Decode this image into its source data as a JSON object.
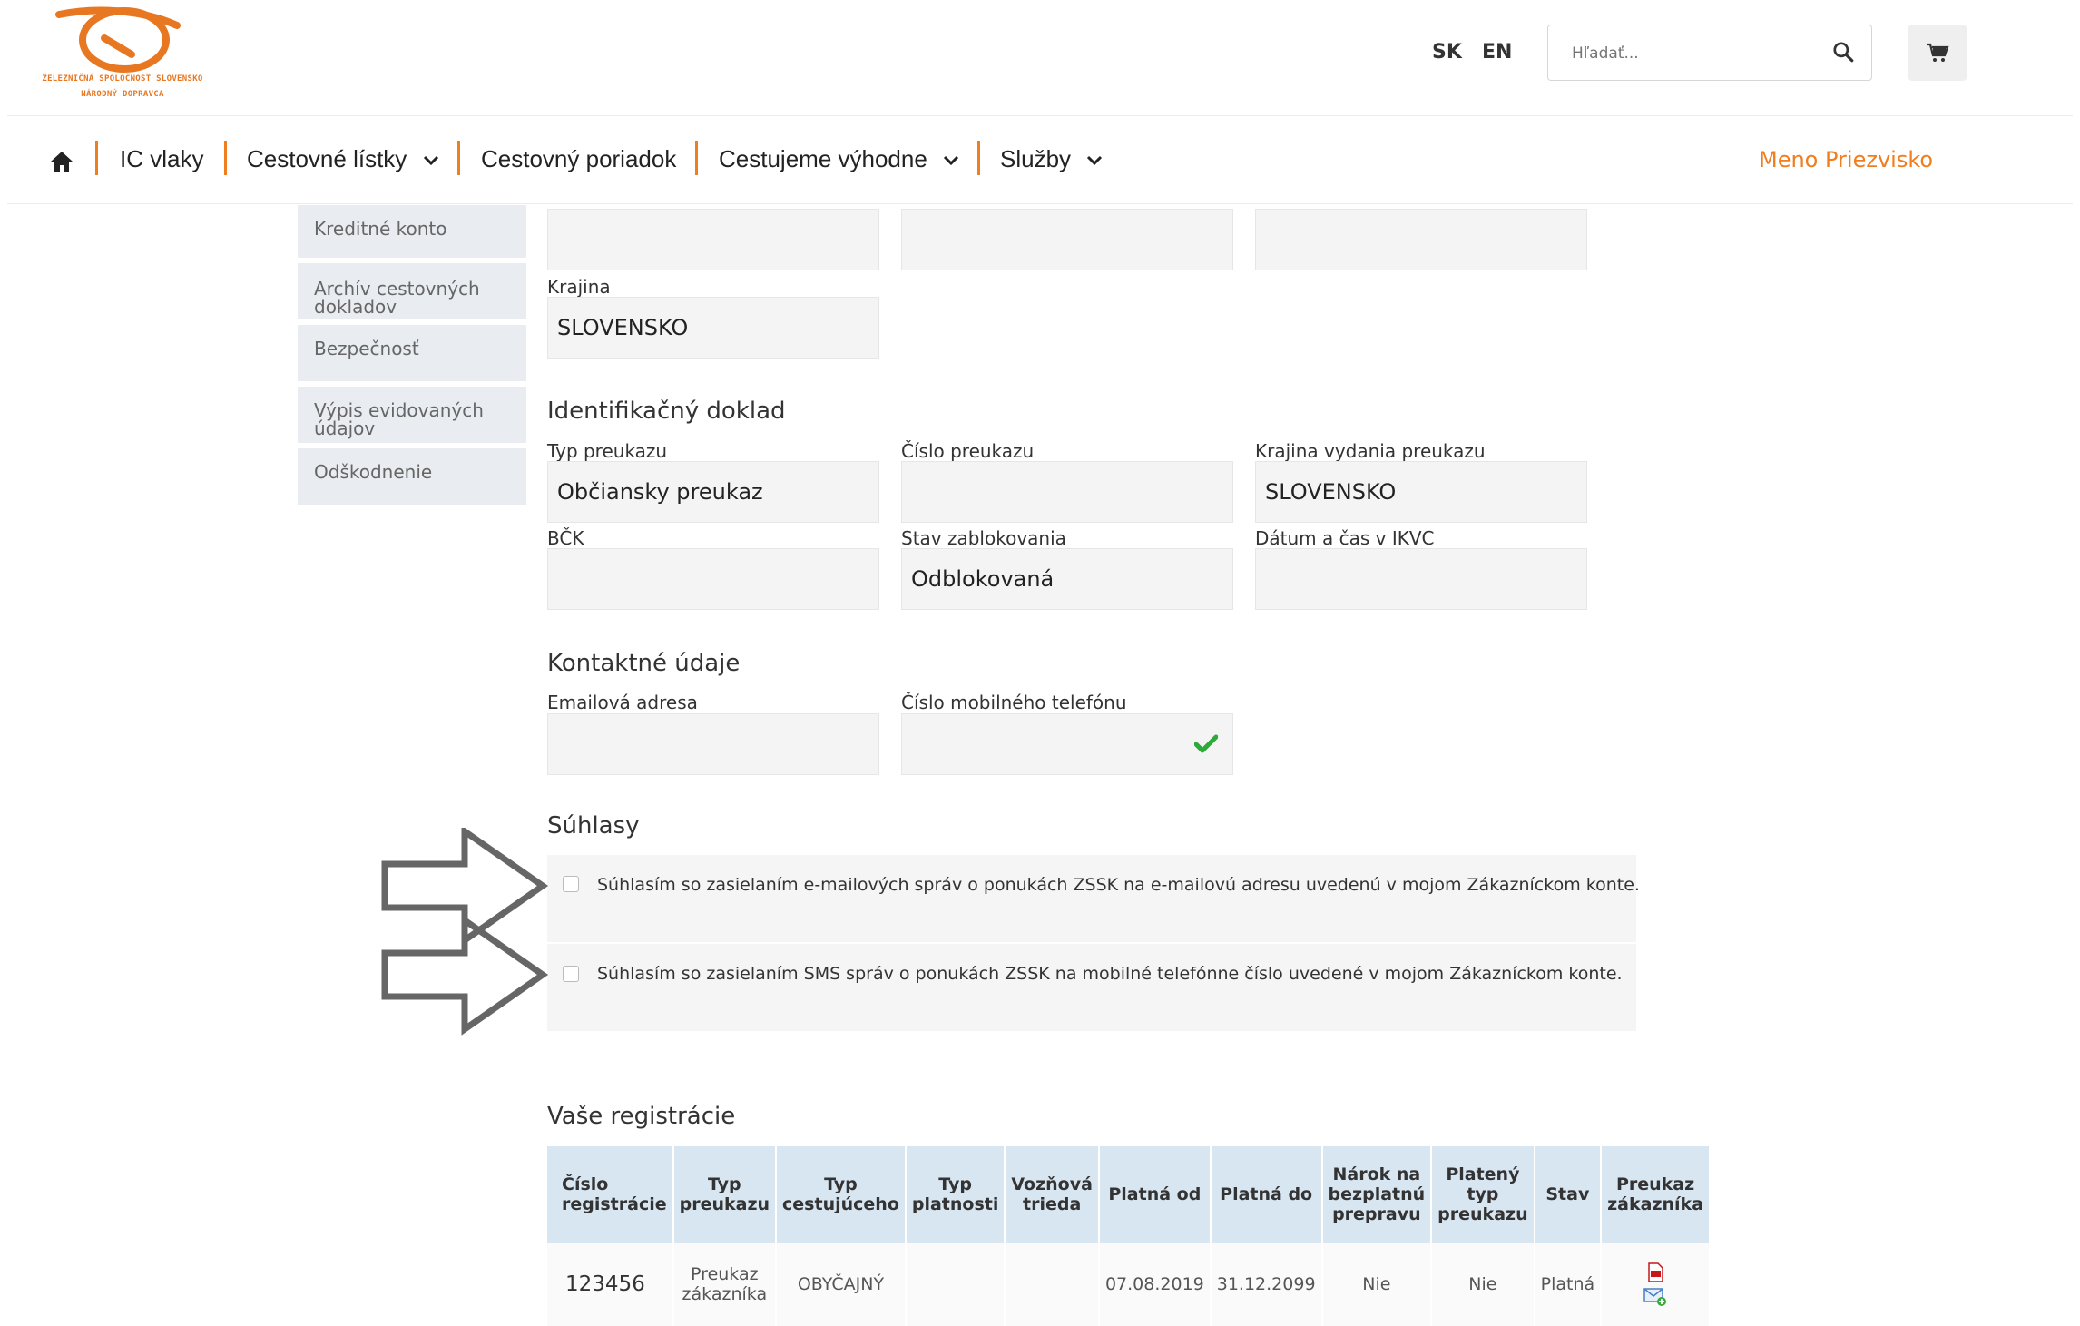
{
  "logo": {
    "line1": "ŽELEZNIČNÁ SPOLOČNOSŤ SLOVENSKO",
    "line2": "NÁRODNÝ DOPRAVCA"
  },
  "header": {
    "lang_sk": "SK",
    "lang_en": "EN",
    "search_placeholder": "Hľadať...",
    "user_name": "Meno Priezvisko"
  },
  "nav": {
    "items": [
      {
        "label": "IC vlaky"
      },
      {
        "label": "Cestovné lístky"
      },
      {
        "label": "Cestovný poriadok"
      },
      {
        "label": "Cestujeme výhodne"
      },
      {
        "label": "Služby"
      }
    ]
  },
  "sidebar": {
    "items": [
      {
        "label": "Kreditné konto"
      },
      {
        "label": "Archív cestovných dokladov"
      },
      {
        "label": "Bezpečnosť"
      },
      {
        "label": "Výpis evidovaných údajov"
      },
      {
        "label": "Odškodnenie"
      }
    ]
  },
  "form": {
    "krajina_label": "Krajina",
    "krajina_value": "SLOVENSKO",
    "id_section": "Identifikačný doklad",
    "typ_preukazu_label": "Typ preukazu",
    "typ_preukazu_value": "Občiansky preukaz",
    "cislo_preukazu_label": "Číslo preukazu",
    "krajina_vydania_label": "Krajina vydania preukazu",
    "krajina_vydania_value": "SLOVENSKO",
    "bck_label": "BČK",
    "stav_label": "Stav zablokovania",
    "stav_value": "Odblokovaná",
    "datum_label": "Dátum a čas v IKVC",
    "kontakt_section": "Kontaktné údaje",
    "email_label": "Emailová adresa",
    "mobil_label": "Číslo mobilného telefónu"
  },
  "consents": {
    "section": "Súhlasy",
    "email": "Súhlasím so zasielaním e-mailových správ o ponukách ZSSK na e-mailovú adresu uvedenú v mojom Zákazníckom konte.",
    "sms": "Súhlasím so zasielaním SMS správ o ponukách ZSSK na mobilné telefónne číslo uvedené v mojom Zákazníckom konte."
  },
  "registrations": {
    "section": "Vaše registrácie",
    "headers": [
      "Číslo registrácie",
      "Typ preukazu",
      "Typ cestujúceho",
      "Typ platnosti",
      "Vozňová trieda",
      "Platná od",
      "Platná do",
      "Nárok na bezplatnú prepravu",
      "Platený typ preukazu",
      "Stav",
      "Preukaz zákazníka"
    ],
    "rows": [
      {
        "cislo": "123456",
        "typ_preukazu": "Preukaz zákazníka",
        "typ_cestujuceho": "OBYČAJNÝ",
        "typ_platnosti": "",
        "trieda": "",
        "od": "07.08.2019",
        "do": "31.12.2099",
        "narok": "Nie",
        "plateny": "Nie",
        "stav": "Platná"
      }
    ]
  }
}
